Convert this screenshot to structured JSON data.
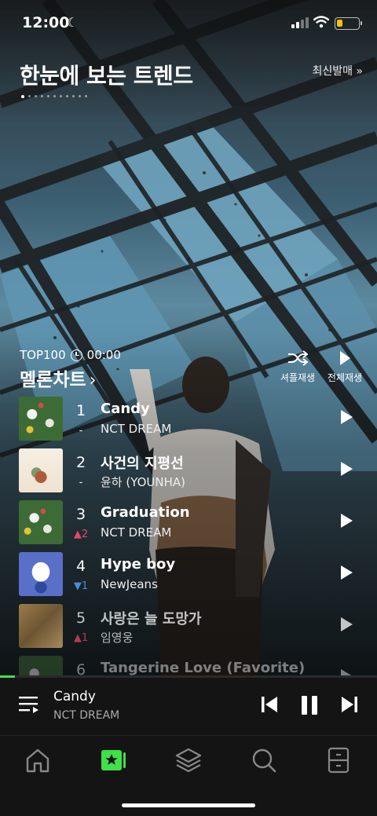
{
  "status_bar": {
    "time": "12:00"
  },
  "header": {
    "title": "한눈에 보는 트렌드",
    "new_release_link": "최신발매 »",
    "page_dots": 11,
    "active_dot": 0
  },
  "chart": {
    "top_label": "TOP100",
    "timer": "00:00",
    "title": "멜론차트",
    "shuffle_label": "셔플재생",
    "play_all_label": "전체재생",
    "tracks": [
      {
        "rank": "1",
        "title": "Candy",
        "artist": "NCT DREAM",
        "change": "-",
        "direction": "same"
      },
      {
        "rank": "2",
        "title": "사건의 지평선",
        "artist": "윤하 (YOUNHA)",
        "change": "-",
        "direction": "same"
      },
      {
        "rank": "3",
        "title": "Graduation",
        "artist": "NCT DREAM",
        "change": "2",
        "direction": "up"
      },
      {
        "rank": "4",
        "title": "Hype boy",
        "artist": "NewJeans",
        "change": "1",
        "direction": "down"
      },
      {
        "rank": "5",
        "title": "사랑은 늘 도망가",
        "artist": "임영웅",
        "change": "1",
        "direction": "up"
      },
      {
        "rank": "6",
        "title": "Tangerine Love (Favorite)",
        "artist": "",
        "change": "",
        "direction": ""
      }
    ]
  },
  "now_playing": {
    "title": "Candy",
    "artist": "NCT DREAM",
    "progress": 0.04
  },
  "tabs": [
    "home",
    "melon-chart",
    "library",
    "search",
    "drawer"
  ],
  "colors": {
    "accent": "#3fe04b",
    "rank_up": "#e04a6a",
    "rank_down": "#4a8ae0"
  }
}
